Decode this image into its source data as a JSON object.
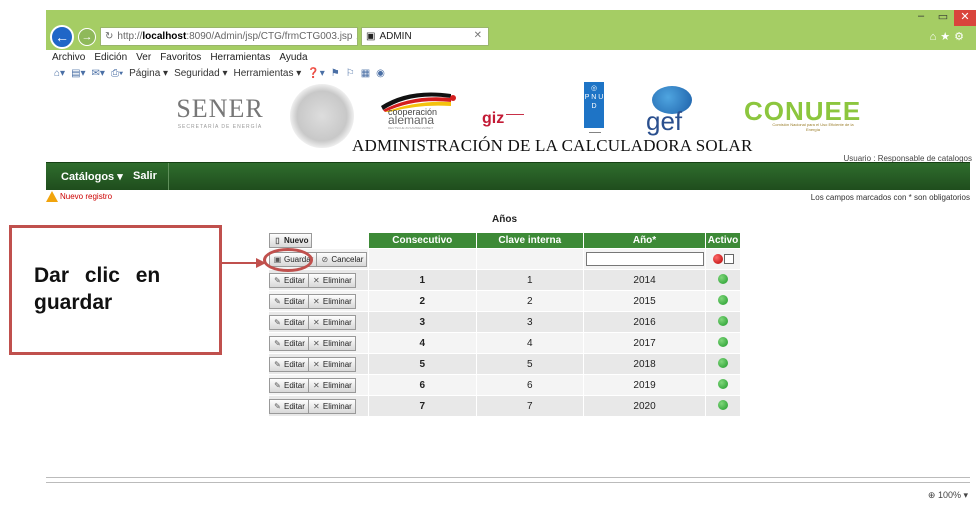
{
  "browser": {
    "url_prefix": "http://",
    "url_host": "localhost",
    "url_rest": ":8090/Admin/jsp/CTG/frmCTG003.jsp",
    "tab_title": "ADMIN",
    "menu": [
      "Archivo",
      "Edición",
      "Ver",
      "Favoritos",
      "Herramientas",
      "Ayuda"
    ],
    "commands": [
      "Página ▾",
      "Seguridad ▾",
      "Herramientas ▾"
    ],
    "zoom": "100%"
  },
  "header": {
    "sener": "SENER",
    "sener_sub": "SECRETARÍA DE ENERGÍA",
    "coop_line1": "cooperación",
    "coop_line2": "alemana",
    "coop_line3": "DEUTSCHE ZUSAMMENARBEIT",
    "giz": "giz",
    "pnud": "P N U D",
    "gef": "gef",
    "conuee": "CONUEE",
    "conuee_sub": "Comisión Nacional para el Uso Eficiente de la Energía",
    "title": "ADMINISTRACIÓN DE LA CALCULADORA SOLAR",
    "user": "Usuario : Responsable de catalogos"
  },
  "nav": {
    "catalogos": "Catálogos",
    "salir": "Salir"
  },
  "notice": {
    "new_record": "Nuevo registro",
    "required": "Los campos marcados con * son obligatorios"
  },
  "table": {
    "title": "Años",
    "headers": {
      "consecutivo": "Consecutivo",
      "clave": "Clave interna",
      "anio": "Año*",
      "activo": "Activo"
    },
    "buttons": {
      "nuevo": "Nuevo",
      "guardar": "Guardar",
      "cancelar": "Cancelar",
      "editar": "Editar",
      "eliminar": "Eliminar"
    },
    "year_input_value": "",
    "rows": [
      {
        "consecutivo": "1",
        "clave": "1",
        "anio": "2014",
        "activo": true
      },
      {
        "consecutivo": "2",
        "clave": "2",
        "anio": "2015",
        "activo": true
      },
      {
        "consecutivo": "3",
        "clave": "3",
        "anio": "2016",
        "activo": true
      },
      {
        "consecutivo": "4",
        "clave": "4",
        "anio": "2017",
        "activo": true
      },
      {
        "consecutivo": "5",
        "clave": "5",
        "anio": "2018",
        "activo": true
      },
      {
        "consecutivo": "6",
        "clave": "6",
        "anio": "2019",
        "activo": true
      },
      {
        "consecutivo": "7",
        "clave": "7",
        "anio": "2020",
        "activo": true
      }
    ]
  },
  "callout": {
    "line1": "Dar clic en",
    "line2": "guardar"
  },
  "colors": {
    "accent_green": "#3d8a37",
    "callout_red": "#c0504d",
    "chrome_green": "#a5cd64"
  }
}
